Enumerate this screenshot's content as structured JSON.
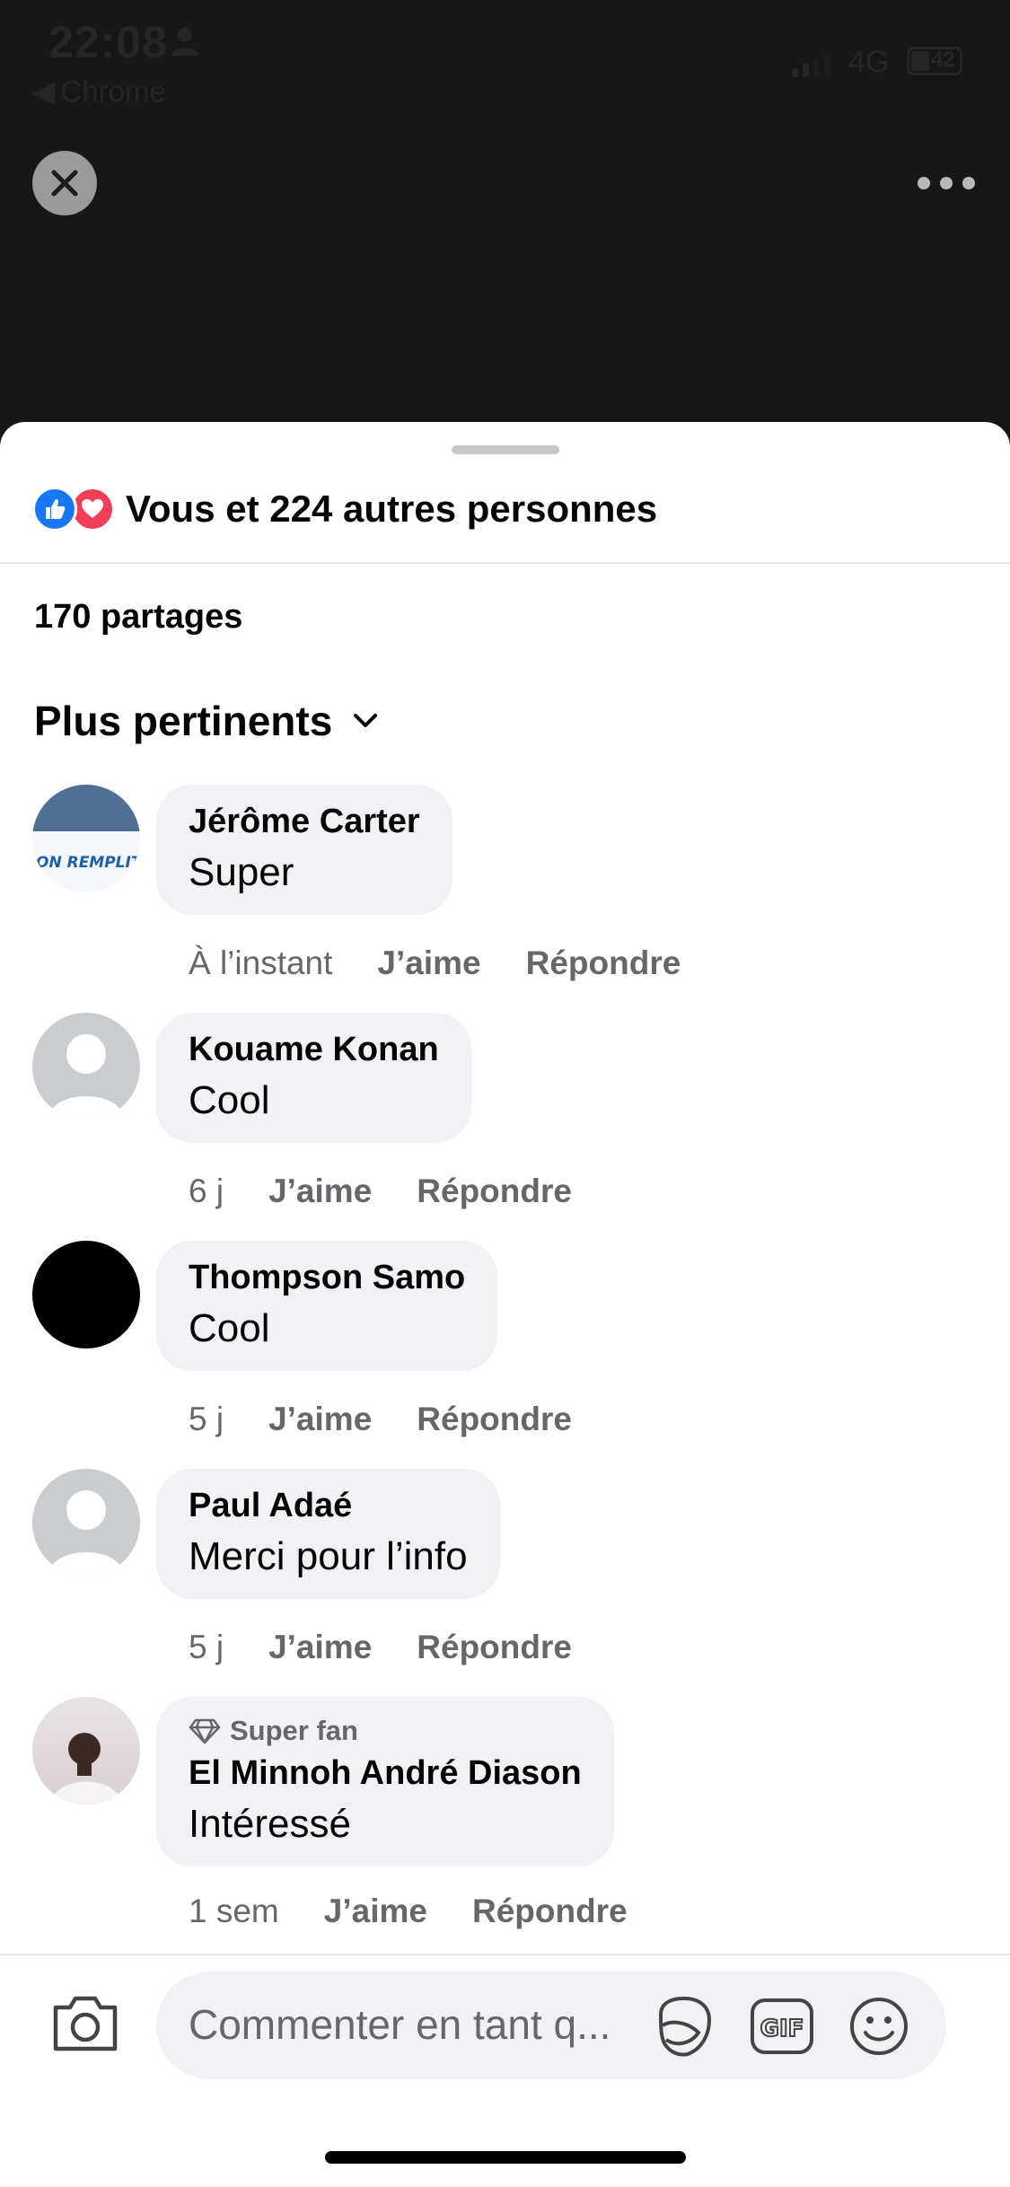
{
  "status_bar": {
    "time": "22:08",
    "back_app": "Chrome",
    "network": "4G",
    "battery": "42"
  },
  "sheet": {
    "reactions_text": "Vous et 224 autres personnes",
    "shares": "170 partages",
    "sort_label": "Plus pertinents"
  },
  "comments": [
    {
      "name": "Jérôme Carter",
      "text": "Super",
      "time": "À l’instant",
      "like": "J’aime",
      "reply": "Répondre"
    },
    {
      "name": "Kouame Konan",
      "text": "Cool",
      "time": "6 j",
      "like": "J’aime",
      "reply": "Répondre"
    },
    {
      "name": "Thompson Samo",
      "text": "Cool",
      "time": "5 j",
      "like": "J’aime",
      "reply": "Répondre"
    },
    {
      "name": "Paul Adaé",
      "text": "Merci pour l’info",
      "time": "5 j",
      "like": "J’aime",
      "reply": "Répondre"
    },
    {
      "badge": "Super fan",
      "name": "El Minnoh André Diason",
      "text": "Intéressé",
      "time": "1 sem",
      "like": "J’aime",
      "reply": "Répondre"
    }
  ],
  "composer": {
    "placeholder": "Commenter en tant q..."
  },
  "avatar_carter_text": "ON REMPLIT LE FRIGO",
  "colors": {
    "like_blue": "#1877f2",
    "love_red": "#f33e58",
    "bubble_bg": "#f0f2f5",
    "meta_gray": "#65676b"
  },
  "icons": [
    "close-icon",
    "more-icon",
    "like-reaction-icon",
    "love-reaction-icon",
    "chevron-down-icon",
    "camera-icon",
    "sticker-icon",
    "gif-icon",
    "emoji-icon",
    "diamond-icon"
  ]
}
